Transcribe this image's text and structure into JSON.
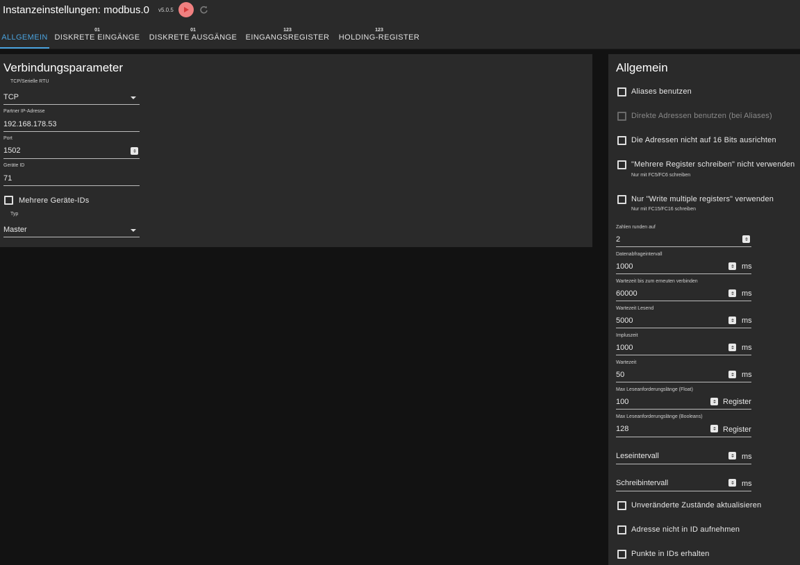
{
  "header": {
    "title": "Instanzeinstellungen: modbus.0",
    "version": "v5.0.5",
    "play_icon": "play-icon",
    "reload_icon": "reload-icon",
    "accent": "#f08080"
  },
  "tabs": [
    {
      "icon": "",
      "label": "ALLGEMEIN",
      "active": true
    },
    {
      "icon": "01",
      "label": "DISKRETE EINGÄNGE"
    },
    {
      "icon": "01",
      "label": "DISKRETE AUSGÄNGE"
    },
    {
      "icon": "123",
      "label": "EINGANGSREGISTER"
    },
    {
      "icon": "123",
      "label": "HOLDING-REGISTER"
    }
  ],
  "left": {
    "title": "Verbindungsparameter",
    "conn_type": {
      "label": "TCP/Serielle RTU",
      "value": "TCP"
    },
    "ip": {
      "label": "Partner IP-Adresse",
      "value": "192.168.178.53"
    },
    "port": {
      "label": "Port",
      "value": "1502"
    },
    "device_id": {
      "label": "Geräte ID",
      "value": "71"
    },
    "multi_ids": {
      "label": "Mehrere Geräte-IDs",
      "checked": false
    },
    "type": {
      "label": "Typ",
      "value": "Master"
    }
  },
  "right": {
    "title": "Allgemein",
    "checks": [
      {
        "label": "Aliases benutzen",
        "help": "",
        "checked": false,
        "disabled": false
      },
      {
        "label": "Direkte Adressen benutzen (bei Aliases)",
        "help": "",
        "checked": false,
        "disabled": true
      },
      {
        "label": "Die Adressen nicht auf 16 Bits ausrichten",
        "help": "",
        "checked": false,
        "disabled": false
      },
      {
        "label": "\"Mehrere Register schreiben\" nicht verwenden",
        "help": "Nur mit FC5/FC6 schreiben",
        "checked": false,
        "disabled": false
      },
      {
        "label": "Nur \"Write multiple registers\" verwenden",
        "help": "Nur mit FC15/FC16 schreiben",
        "checked": false,
        "disabled": false
      }
    ],
    "fields": [
      {
        "label": "Zahlen runden auf",
        "value": "2",
        "unit": ""
      },
      {
        "label": "Datenabfrageintervall",
        "value": "1000",
        "unit": "ms"
      },
      {
        "label": "Wartezeit bis zum erneuten verbinden",
        "value": "60000",
        "unit": "ms"
      },
      {
        "label": "Wartezeit Lesend",
        "value": "5000",
        "unit": "ms"
      },
      {
        "label": "Impluszeit",
        "value": "1000",
        "unit": "ms"
      },
      {
        "label": "Wartezeit",
        "value": "50",
        "unit": "ms"
      },
      {
        "label": "Max Leseanforderungslänge (Float)",
        "value": "100",
        "unit": "Register"
      },
      {
        "label": "Max Leseanforderungslänge (Booleans)",
        "value": "128",
        "unit": "Register"
      }
    ],
    "empty_fields": [
      {
        "placeholder": "Leseintervall",
        "unit": "ms"
      },
      {
        "placeholder": "Schreibintervall",
        "unit": "ms"
      }
    ],
    "bottom_checks": [
      {
        "label": "Unveränderte Zustände aktualisieren",
        "checked": false
      },
      {
        "label": "Adresse nicht in ID aufnehmen",
        "checked": false
      },
      {
        "label": "Punkte in IDs erhalten",
        "checked": false
      }
    ]
  }
}
